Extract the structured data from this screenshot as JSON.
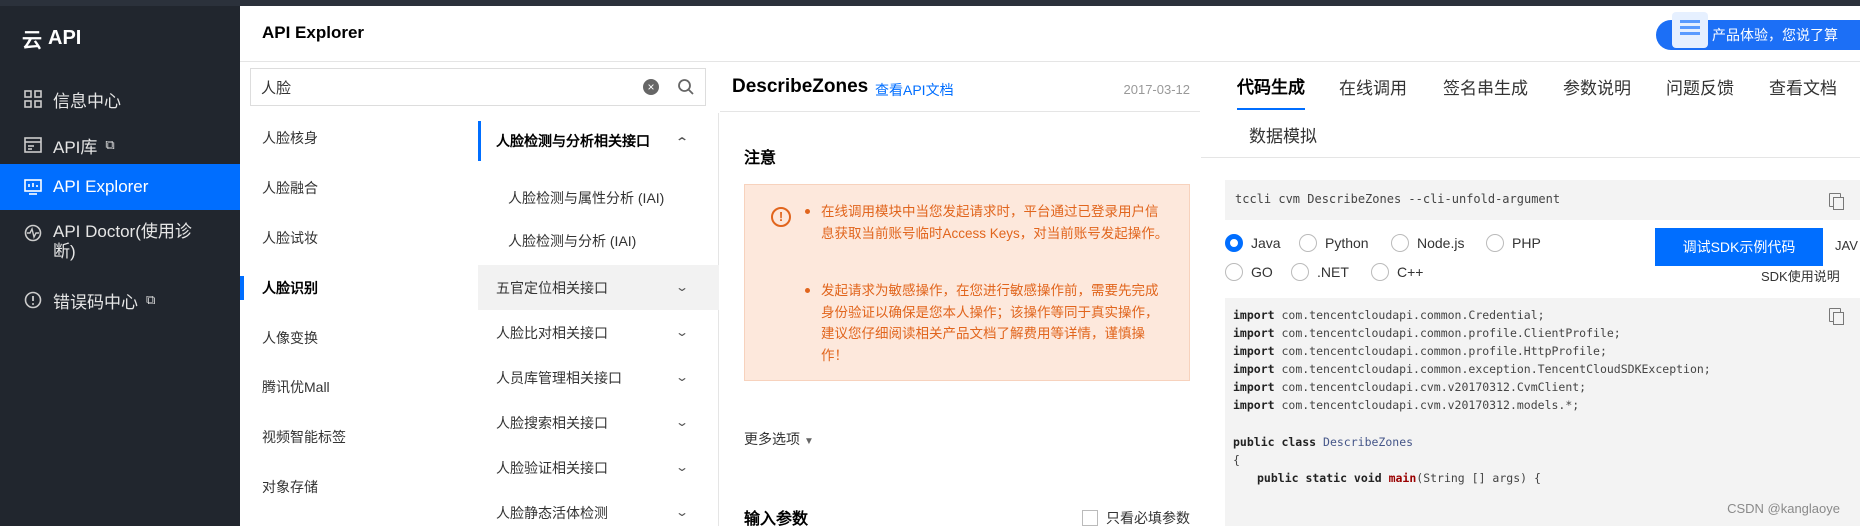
{
  "nav": {
    "brand": "API",
    "items": [
      {
        "label": "信息中心",
        "icon": "grid-icon",
        "external": false,
        "active": false
      },
      {
        "label": "API库",
        "icon": "library-icon",
        "external": true,
        "active": false
      },
      {
        "label": "API Explorer",
        "icon": "monitor-icon",
        "external": false,
        "active": true
      },
      {
        "label": "API Doctor(使用诊断)",
        "icon": "pulse-icon",
        "external": false,
        "active": false
      },
      {
        "label": "错误码中心",
        "icon": "info-icon",
        "external": true,
        "active": false
      }
    ]
  },
  "header": {
    "title": "API Explorer",
    "promo": "产品体验，您说了算"
  },
  "search": {
    "value": "人脸"
  },
  "categories": [
    {
      "label": "人脸核身",
      "active": false
    },
    {
      "label": "人脸融合",
      "active": false
    },
    {
      "label": "人脸试妆",
      "active": false
    },
    {
      "label": "人脸识别",
      "active": true
    },
    {
      "label": "人像变换",
      "active": false
    },
    {
      "label": "腾讯优Mall",
      "active": false
    },
    {
      "label": "视频智能标签",
      "active": false
    },
    {
      "label": "对象存储",
      "active": false
    }
  ],
  "api_groups": {
    "open_group": "人脸检测与分析相关接口",
    "open_subs": [
      "人脸检测与属性分析 (IAI)",
      "人脸检测与分析 (IAI)"
    ],
    "groups": [
      "五官定位相关接口",
      "人脸比对相关接口",
      "人员库管理相关接口",
      "人脸搜索相关接口",
      "人脸验证相关接口",
      "人脸静态活体检测"
    ]
  },
  "detail": {
    "api_name": "DescribeZones",
    "doc_link": "查看API文档",
    "date": "2017-03-12",
    "notice_title": "注意",
    "notices": [
      "在线调用模块中当您发起请求时，平台通过已登录用户信息获取当前账号临时Access Keys，对当前账号发起操作。",
      "发起请求为敏感操作，在您进行敏感操作前，需要先完成身份验证以确保是您本人操作；该操作等同于真实操作，建议您仔细阅读相关产品文档了解费用等详情，谨慎操作！"
    ],
    "more_options": "更多选项",
    "params_title": "输入参数",
    "required_only": "只看必填参数"
  },
  "right": {
    "tabs": [
      "代码生成",
      "在线调用",
      "签名串生成",
      "参数说明",
      "问题反馈",
      "查看文档",
      "数据模拟"
    ],
    "active_tab": "代码生成",
    "cli": "tccli cvm DescribeZones --cli-unfold-argument",
    "languages": [
      "Java",
      "Python",
      "Node.js",
      "PHP",
      "GO",
      ".NET",
      "C++"
    ],
    "selected_language": "Java",
    "sdk_button": "调试SDK示例代码",
    "sdk_lang_cut": "JAV",
    "sdk_doc": "SDK使用说明",
    "code": [
      {
        "kw": "import",
        "rest": " com.tencentcloudapi.common.Credential;"
      },
      {
        "kw": "import",
        "rest": " com.tencentcloudapi.common.profile.ClientProfile;"
      },
      {
        "kw": "import",
        "rest": " com.tencentcloudapi.common.profile.HttpProfile;"
      },
      {
        "kw": "import",
        "rest": " com.tencentcloudapi.common.exception.TencentCloudSDKException;"
      },
      {
        "kw": "import",
        "rest": " com.tencentcloudapi.cvm.v20170312.CvmClient;"
      },
      {
        "kw": "import",
        "rest": " com.tencentcloudapi.cvm.v20170312.models.*;"
      }
    ],
    "class_kw": "public class",
    "class_name": "DescribeZones",
    "brace": "{",
    "main_kw": "public static void",
    "main_fn": "main",
    "main_args": "(String [] args) {"
  },
  "watermark": "CSDN @kanglaoye",
  "colors": {
    "nav_bg": "#21262e",
    "accent": "#006eff",
    "warning": "#e1651d",
    "notice_bg": "#fde8dc"
  }
}
